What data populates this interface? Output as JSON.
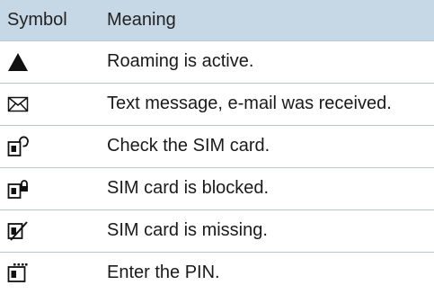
{
  "table": {
    "header": {
      "symbol": "Symbol",
      "meaning": "Meaning"
    },
    "rows": [
      {
        "icon": "roaming-triangle-icon",
        "meaning": "Roaming is active."
      },
      {
        "icon": "envelope-icon",
        "meaning": "Text message, e-mail was received."
      },
      {
        "icon": "sim-check-icon",
        "meaning": "Check the SIM card."
      },
      {
        "icon": "sim-blocked-icon",
        "meaning": "SIM card is blocked."
      },
      {
        "icon": "sim-missing-icon",
        "meaning": "SIM card is missing."
      },
      {
        "icon": "sim-pin-icon",
        "meaning": "Enter the PIN."
      }
    ]
  },
  "colors": {
    "header_background": "#c6d7e6",
    "row_divider": "#b6c7d6",
    "text": "#1a1a1a"
  }
}
